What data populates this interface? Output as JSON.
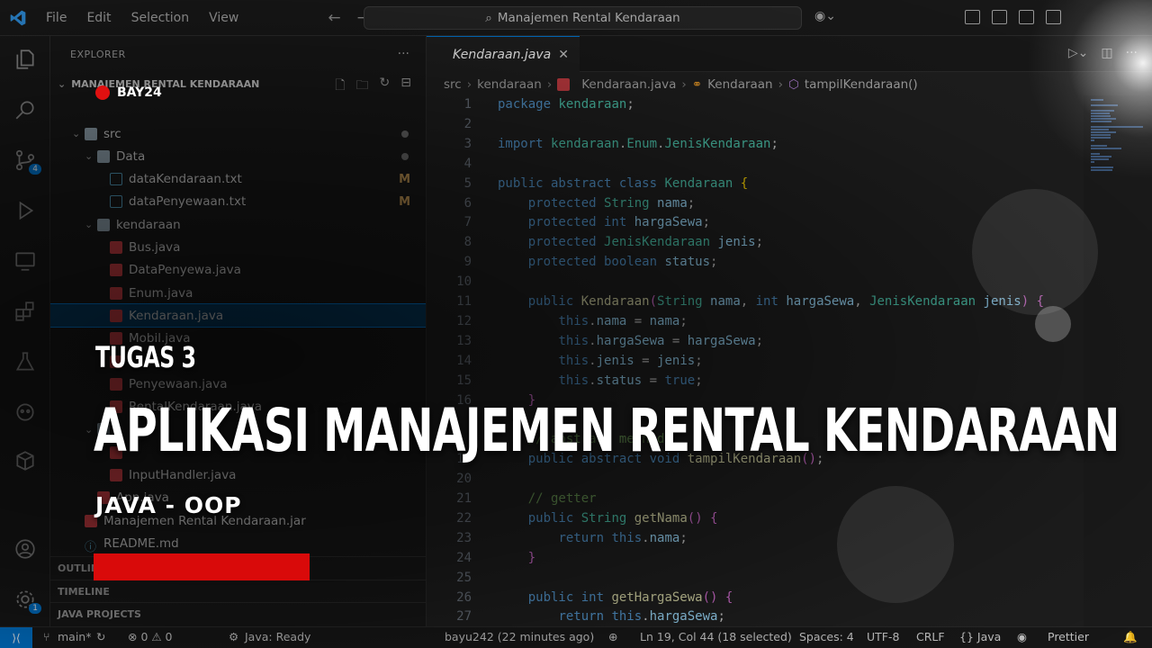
{
  "titlebar": {
    "menu": [
      "File",
      "Edit",
      "Selection",
      "View"
    ],
    "command_center": "Manajemen Rental Kendaraan"
  },
  "activity": {
    "source_control_badge": "4",
    "settings_badge": "1"
  },
  "sidebar": {
    "title": "EXPLORER",
    "project": "MANAJEMEN RENTAL KENDARAAN",
    "tree": [
      {
        "label": "src",
        "kind": "folder",
        "indent": 1,
        "mark": "dot"
      },
      {
        "label": "Data",
        "kind": "folder",
        "indent": 2,
        "mark": "dot"
      },
      {
        "label": "dataKendaraan.txt",
        "kind": "txt",
        "indent": 3,
        "mark": "M"
      },
      {
        "label": "dataPenyewaan.txt",
        "kind": "txt",
        "indent": 3,
        "mark": "M"
      },
      {
        "label": "kendaraan",
        "kind": "folder",
        "indent": 2,
        "mark": ""
      },
      {
        "label": "Bus.java",
        "kind": "java",
        "indent": 3,
        "mark": ""
      },
      {
        "label": "DataPenyewa.java",
        "kind": "java",
        "indent": 3,
        "mark": ""
      },
      {
        "label": "Enum.java",
        "kind": "java",
        "indent": 3,
        "mark": ""
      },
      {
        "label": "Kendaraan.java",
        "kind": "java",
        "indent": 3,
        "mark": "",
        "selected": true
      },
      {
        "label": "Mobil.java",
        "kind": "java",
        "indent": 3,
        "mark": ""
      },
      {
        "label": "",
        "kind": "java",
        "indent": 3,
        "mark": ""
      },
      {
        "label": "Penyewaan.java",
        "kind": "java",
        "indent": 3,
        "mark": ""
      },
      {
        "label": "RentalKendaraan.java",
        "kind": "java",
        "indent": 3,
        "mark": ""
      },
      {
        "label": "",
        "kind": "folder",
        "indent": 2,
        "mark": ""
      },
      {
        "label": "",
        "kind": "java",
        "indent": 3,
        "mark": ""
      },
      {
        "label": "InputHandler.java",
        "kind": "java",
        "indent": 3,
        "mark": ""
      },
      {
        "label": "App.java",
        "kind": "java",
        "indent": 2,
        "mark": ""
      },
      {
        "label": "Manajemen Rental Kendaraan.jar",
        "kind": "java",
        "indent": 1,
        "mark": ""
      },
      {
        "label": "README.md",
        "kind": "info",
        "indent": 1,
        "mark": ""
      }
    ],
    "sections": [
      "OUTLINE",
      "TIMELINE",
      "JAVA PROJECTS"
    ]
  },
  "editor": {
    "tab": "Kendaraan.java",
    "breadcrumb": [
      "src",
      "kendaraan",
      "Kendaraan.java",
      "Kendaraan",
      "tampilKendaraan()"
    ],
    "lines": [
      {
        "n": "1",
        "h": "<span class='kw'>package</span> <span class='ty'>kendaraan</span>;"
      },
      {
        "n": "2",
        "h": ""
      },
      {
        "n": "3",
        "h": "<span class='kw'>import</span> <span class='ty'>kendaraan</span>.<span class='ty'>Enum</span>.<span class='ty'>JenisKendaraan</span>;"
      },
      {
        "n": "4",
        "h": ""
      },
      {
        "n": "5",
        "h": "<span class='kw'>public abstract class</span> <span class='ty'>Kendaraan</span> <span class='br'>{</span>"
      },
      {
        "n": "6",
        "h": "    <span class='kw'>protected</span> <span class='ty'>String</span> <span class='vr'>nama</span>;"
      },
      {
        "n": "7",
        "h": "    <span class='kw'>protected int</span> <span class='vr'>hargaSewa</span>;"
      },
      {
        "n": "8",
        "h": "    <span class='kw'>protected</span> <span class='ty'>JenisKendaraan</span> <span class='vr'>jenis</span>;"
      },
      {
        "n": "9",
        "h": "    <span class='kw'>protected boolean</span> <span class='vr'>status</span>;"
      },
      {
        "n": "10",
        "h": ""
      },
      {
        "n": "11",
        "h": "    <span class='kw'>public</span> <span class='fn'>Kendaraan</span><span class='br2'>(</span><span class='ty'>String</span> <span class='vr'>nama</span>, <span class='kw'>int</span> <span class='vr'>hargaSewa</span>, <span class='ty'>JenisKendaraan</span> <span class='vr'>jenis</span><span class='br2'>)</span> <span class='br2'>{</span>"
      },
      {
        "n": "12",
        "h": "        <span class='kw'>this</span>.<span class='vr'>nama</span> = <span class='vr'>nama</span>;"
      },
      {
        "n": "13",
        "h": "        <span class='kw'>this</span>.<span class='vr'>hargaSewa</span> = <span class='vr'>hargaSewa</span>;"
      },
      {
        "n": "14",
        "h": "        <span class='kw'>this</span>.<span class='vr'>jenis</span> = <span class='vr'>jenis</span>;"
      },
      {
        "n": "15",
        "h": "        <span class='kw'>this</span>.<span class='vr'>status</span> = <span class='kw'>true</span>;"
      },
      {
        "n": "16",
        "h": "    <span class='br2'>}</span>"
      },
      {
        "n": "",
        "h": ""
      },
      {
        "n": "",
        "h": "    <span class='cm'>// abstract method</span>"
      },
      {
        "n": "19",
        "h": "    <span class='kw'>public abstract void</span> <span class='fn'>tampilKendaraan</span><span class='br2'>()</span>;"
      },
      {
        "n": "20",
        "h": ""
      },
      {
        "n": "21",
        "h": "    <span class='cm'>// getter</span>"
      },
      {
        "n": "22",
        "h": "    <span class='kw'>public</span> <span class='ty'>String</span> <span class='fn'>getNama</span><span class='br2'>()</span> <span class='br2'>{</span>"
      },
      {
        "n": "23",
        "h": "        <span class='kw'>return this</span>.<span class='vr'>nama</span>;"
      },
      {
        "n": "24",
        "h": "    <span class='br2'>}</span>"
      },
      {
        "n": "25",
        "h": ""
      },
      {
        "n": "26",
        "h": "    <span class='kw'>public int</span> <span class='fn'>getHargaSewa</span><span class='br2'>()</span> <span class='br2'>{</span>"
      },
      {
        "n": "27",
        "h": "        <span class='kw'>return this</span>.<span class='vr'>hargaSewa</span>;"
      }
    ]
  },
  "status": {
    "branch": "main*",
    "problems": "⊗ 0 ⚠ 0",
    "java": "Java: Ready",
    "blame": "bayu242 (22 minutes ago)",
    "cursor": "Ln 19, Col 44 (18 selected)",
    "spaces": "Spaces: 4",
    "encoding": "UTF-8",
    "eol": "CRLF",
    "language": "{} Java",
    "prettier": "Prettier"
  },
  "overlay": {
    "brand": "BAY24",
    "small_title": "TUGAS 3",
    "main_title": "APLIKASI MANAJEMEN RENTAL KENDARAAN",
    "subtitle": "JAVA - OOP",
    "accent": "#d90a0a"
  }
}
